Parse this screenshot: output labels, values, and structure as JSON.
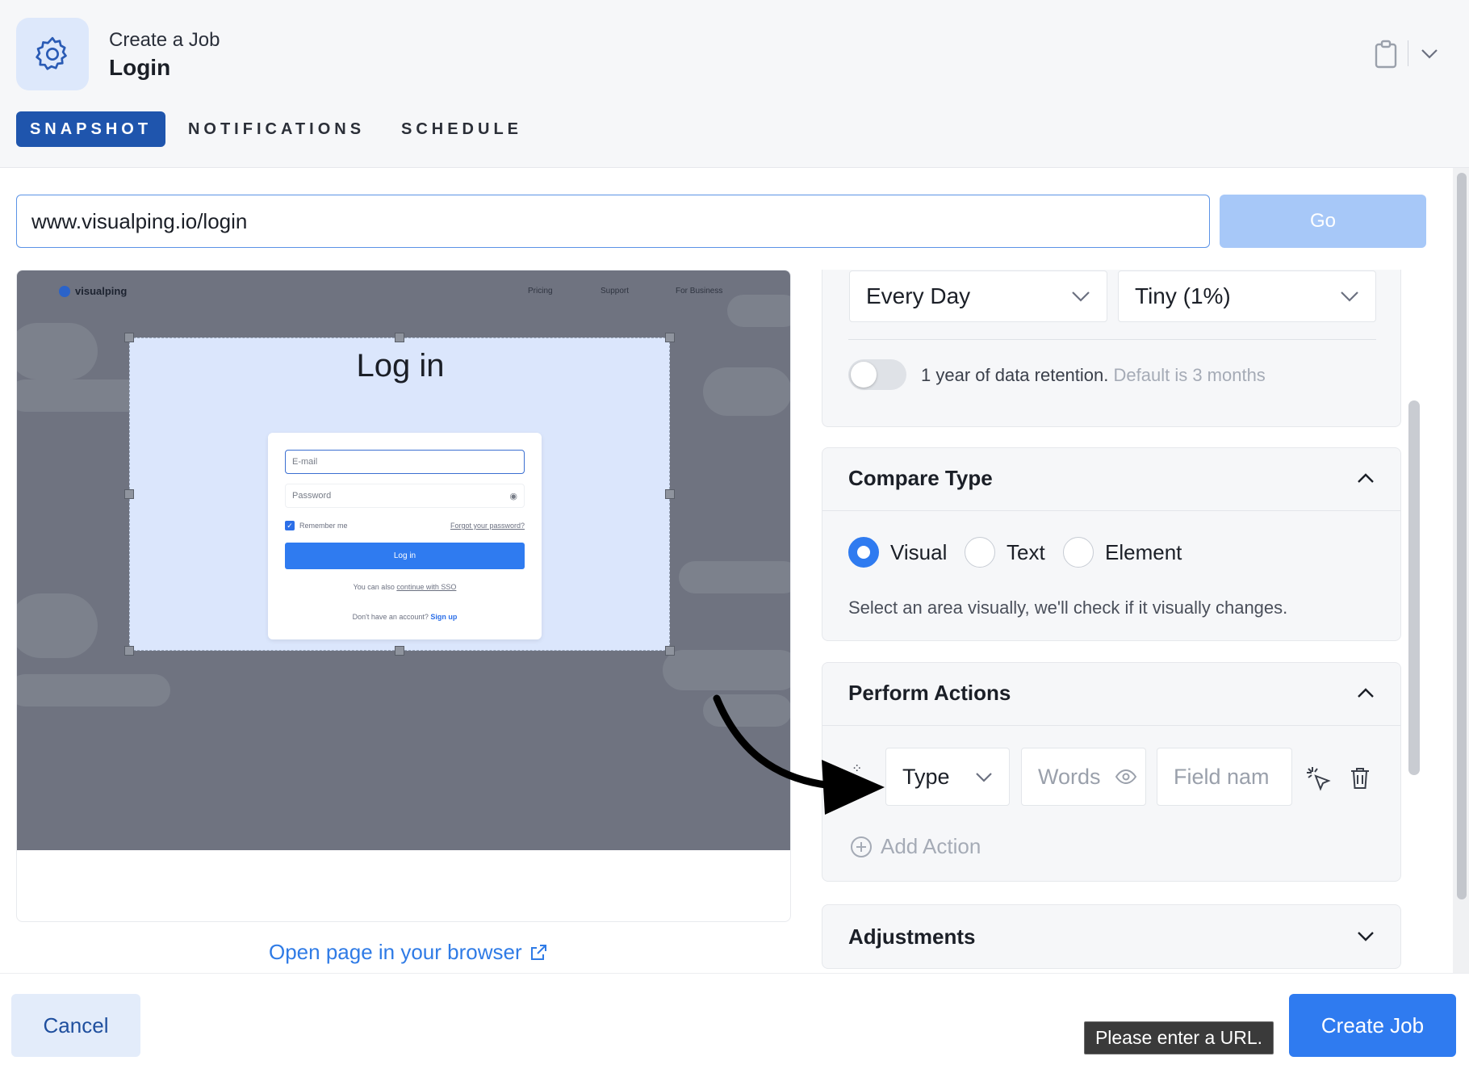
{
  "header": {
    "subtitle": "Create a Job",
    "title": "Login",
    "icon": "gear-icon",
    "clipboard_icon": "clipboard-icon",
    "menu_icon": "chevron-down-icon"
  },
  "tabs": [
    {
      "label": "SNAPSHOT",
      "active": true
    },
    {
      "label": "NOTIFICATIONS",
      "active": false
    },
    {
      "label": "SCHEDULE",
      "active": false
    }
  ],
  "url_bar": {
    "value": "www.visualping.io/login",
    "go_label": "Go"
  },
  "preview": {
    "site": {
      "logo_text": "visualping",
      "nav": [
        "Pricing",
        "Support",
        "For Business"
      ],
      "heading": "Log in",
      "email_placeholder": "E-mail",
      "password_placeholder": "Password",
      "remember_label": "Remember me",
      "forgot_label": "Forgot your password?",
      "login_button": "Log in",
      "sso_prefix": "You can also",
      "sso_link": "continue with SSO",
      "signup_prefix": "Don't have an account?",
      "signup_link": "Sign up"
    },
    "open_link": "Open page in your browser"
  },
  "settings": {
    "frequency": "Every Day",
    "sensitivity": "Tiny (1%)",
    "retention_text": "1 year of data retention.",
    "retention_muted": "Default is 3 months",
    "retention_enabled": false
  },
  "compare_type": {
    "title": "Compare Type",
    "options": [
      {
        "label": "Visual",
        "selected": true
      },
      {
        "label": "Text",
        "selected": false
      },
      {
        "label": "Element",
        "selected": false
      }
    ],
    "help": "Select an area visually, we'll check if it visually changes."
  },
  "perform_actions": {
    "title": "Perform Actions",
    "action_type": "Type",
    "words_placeholder": "Words",
    "field_placeholder": "Field nam",
    "add_action": "Add Action"
  },
  "adjustments": {
    "title": "Adjustments"
  },
  "footer": {
    "cancel_label": "Cancel",
    "create_label": "Create Job",
    "tooltip": "Please enter a URL."
  },
  "colors": {
    "primary": "#2f7bf0",
    "tab_active": "#1f55ad",
    "go_disabled": "#a7c8f8"
  }
}
